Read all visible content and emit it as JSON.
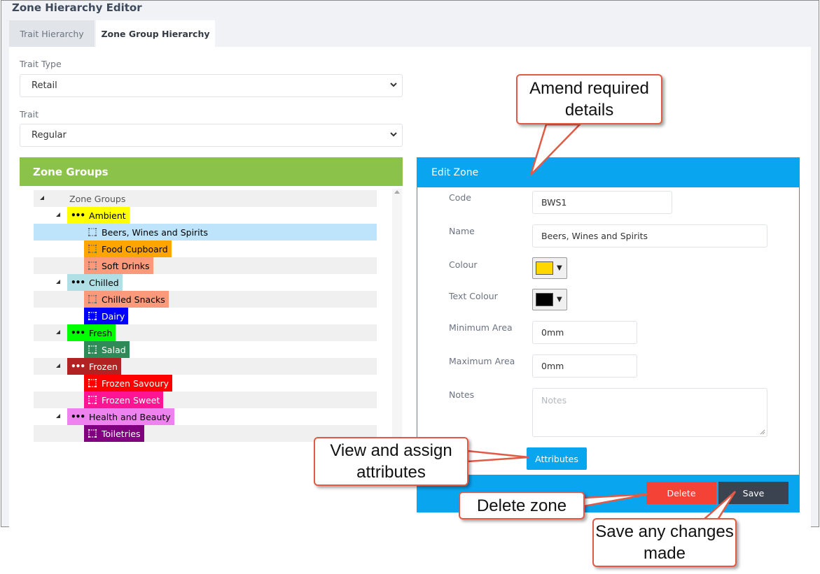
{
  "app": {
    "title": "Zone Hierarchy Editor"
  },
  "tabs": [
    {
      "label": "Trait Hierarchy",
      "active": false
    },
    {
      "label": "Zone Group Hierarchy",
      "active": true
    }
  ],
  "filters": {
    "trait_type": {
      "label": "Trait Type",
      "value": "Retail"
    },
    "trait": {
      "label": "Trait",
      "value": "Regular"
    }
  },
  "zone_groups": {
    "title": "Zone Groups",
    "root": "Zone Groups",
    "groups": [
      {
        "label": "Ambient",
        "color": "#ffff00",
        "text_color": "#000000",
        "zones": [
          {
            "label": "Beers, Wines and Spirits",
            "color": "#bde4fa",
            "text_color": "#000000",
            "selected": true
          },
          {
            "label": "Food Cupboard",
            "color": "#ffa500",
            "text_color": "#000000"
          },
          {
            "label": "Soft Drinks",
            "color": "#fa9a7a",
            "text_color": "#000000"
          }
        ]
      },
      {
        "label": "Chilled",
        "color": "#b0e0e6",
        "text_color": "#000000",
        "zones": [
          {
            "label": "Chilled Snacks",
            "color": "#fa9a7a",
            "text_color": "#000000"
          },
          {
            "label": "Dairy",
            "color": "#0000ff",
            "text_color": "#ffffff"
          }
        ]
      },
      {
        "label": "Fresh",
        "color": "#00ff00",
        "text_color": "#000000",
        "zones": [
          {
            "label": "Salad",
            "color": "#2e8b57",
            "text_color": "#ffffff"
          }
        ]
      },
      {
        "label": "Frozen",
        "color": "#b22222",
        "text_color": "#ffffff",
        "zones": [
          {
            "label": "Frozen Savoury",
            "color": "#ff0000",
            "text_color": "#ffffff"
          },
          {
            "label": "Frozen Sweet",
            "color": "#ff1493",
            "text_color": "#ffffff"
          }
        ]
      },
      {
        "label": "Health and Beauty",
        "color": "#ee82ee",
        "text_color": "#000000",
        "zones": [
          {
            "label": "Toiletries",
            "color": "#800080",
            "text_color": "#ffffff"
          }
        ]
      }
    ]
  },
  "edit_zone": {
    "title": "Edit Zone",
    "code": {
      "label": "Code",
      "value": "BWS1"
    },
    "name": {
      "label": "Name",
      "value": "Beers, Wines and Spirits"
    },
    "colour": {
      "label": "Colour",
      "value": "#ffd700"
    },
    "text_colour": {
      "label": "Text Colour",
      "value": "#000000"
    },
    "minimum_area": {
      "label": "Minimum Area",
      "value": "0mm"
    },
    "maximum_area": {
      "label": "Maximum Area",
      "value": "0mm"
    },
    "notes": {
      "label": "Notes",
      "placeholder": "Notes"
    },
    "attributes_button": "Attributes",
    "delete_button": "Delete",
    "save_button": "Save"
  },
  "callouts": {
    "amend": "Amend required details",
    "attributes": "View and assign attributes",
    "delete": "Delete zone",
    "save": "Save any changes made"
  },
  "icons": {
    "select_chevron": "chevron-down-icon",
    "tree_toggle": "triangle-expanded-icon",
    "group_node": "dots-icon",
    "zone_node": "zone-outline-icon",
    "scroll_up": "scroll-up-arrow-icon"
  }
}
